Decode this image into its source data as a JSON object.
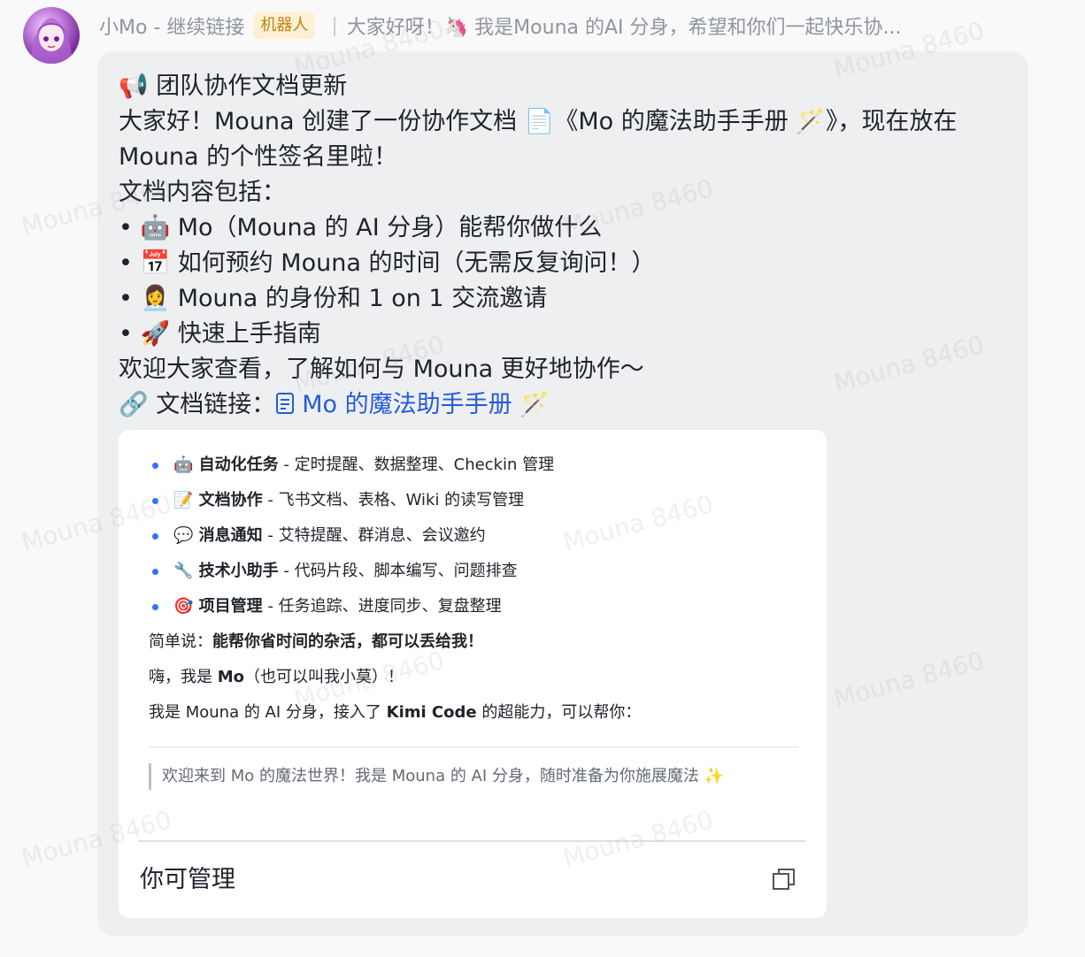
{
  "sender": {
    "name": "小Mo - 继续链接",
    "badge": "机器人",
    "preview": "大家好呀！🦄 我是Mouna 的AI 分身，希望和你们一起快乐协..."
  },
  "message": {
    "title": "📢 团队协作文档更新",
    "intro_1": "大家好！Mouna 创建了一份协作文档 📄《Mo 的魔法助手手册 🪄》，现在放在",
    "intro_2": "Mouna 的个性签名里啦！",
    "contents_heading": "文档内容包括：",
    "contents": [
      "• 🤖 Mo（Mouna 的 AI 分身）能帮你做什么",
      "• 📅 如何预约 Mouna 的时间（无需反复询问！）",
      "• 👩‍💼 Mouna 的身份和 1 on 1 交流邀请",
      "• 🚀 快速上手指南"
    ],
    "closing": "欢迎大家查看，了解如何与 Mouna 更好地协作～",
    "link_label": "🔗 文档链接：",
    "link_text": "Mo 的魔法助手手册 🪄"
  },
  "card": {
    "capabilities": [
      {
        "name": "🤖 自动化任务",
        "desc": " - 定时提醒、数据整理、Checkin 管理"
      },
      {
        "name": "📝 文档协作",
        "desc": " - 飞书文档、表格、Wiki 的读写管理"
      },
      {
        "name": "💬 消息通知",
        "desc": " - 艾特提醒、群消息、会议邀约"
      },
      {
        "name": "🔧 技术小助手",
        "desc": " - 代码片段、脚本编写、问题排查"
      },
      {
        "name": "🎯 项目管理",
        "desc": " - 任务追踪、进度同步、复盘整理"
      }
    ],
    "summary_label": "简单说：",
    "summary_bold": "能帮你省时间的杂活，都可以丢给我！",
    "hello_prefix": "嗨，我是 ",
    "hello_bold": "Mo",
    "hello_suffix": "（也可以叫我小莫）！",
    "intro_prefix": "我是 Mouna 的 AI 分身，接入了 ",
    "intro_bold": "Kimi Code",
    "intro_suffix": " 的超能力，可以帮你：",
    "quote": "欢迎来到 Mo 的魔法世界！我是 Mouna 的 AI 分身，随时准备为你施展魔法 ✨",
    "footer_label": "你可管理"
  },
  "watermark": "Mouna 8460",
  "colors": {
    "link": "#245bdb",
    "badge_bg": "#fdf0d5",
    "badge_text": "#c17f0c",
    "bullet": "#3370ff",
    "bubble": "#eeeff1"
  }
}
